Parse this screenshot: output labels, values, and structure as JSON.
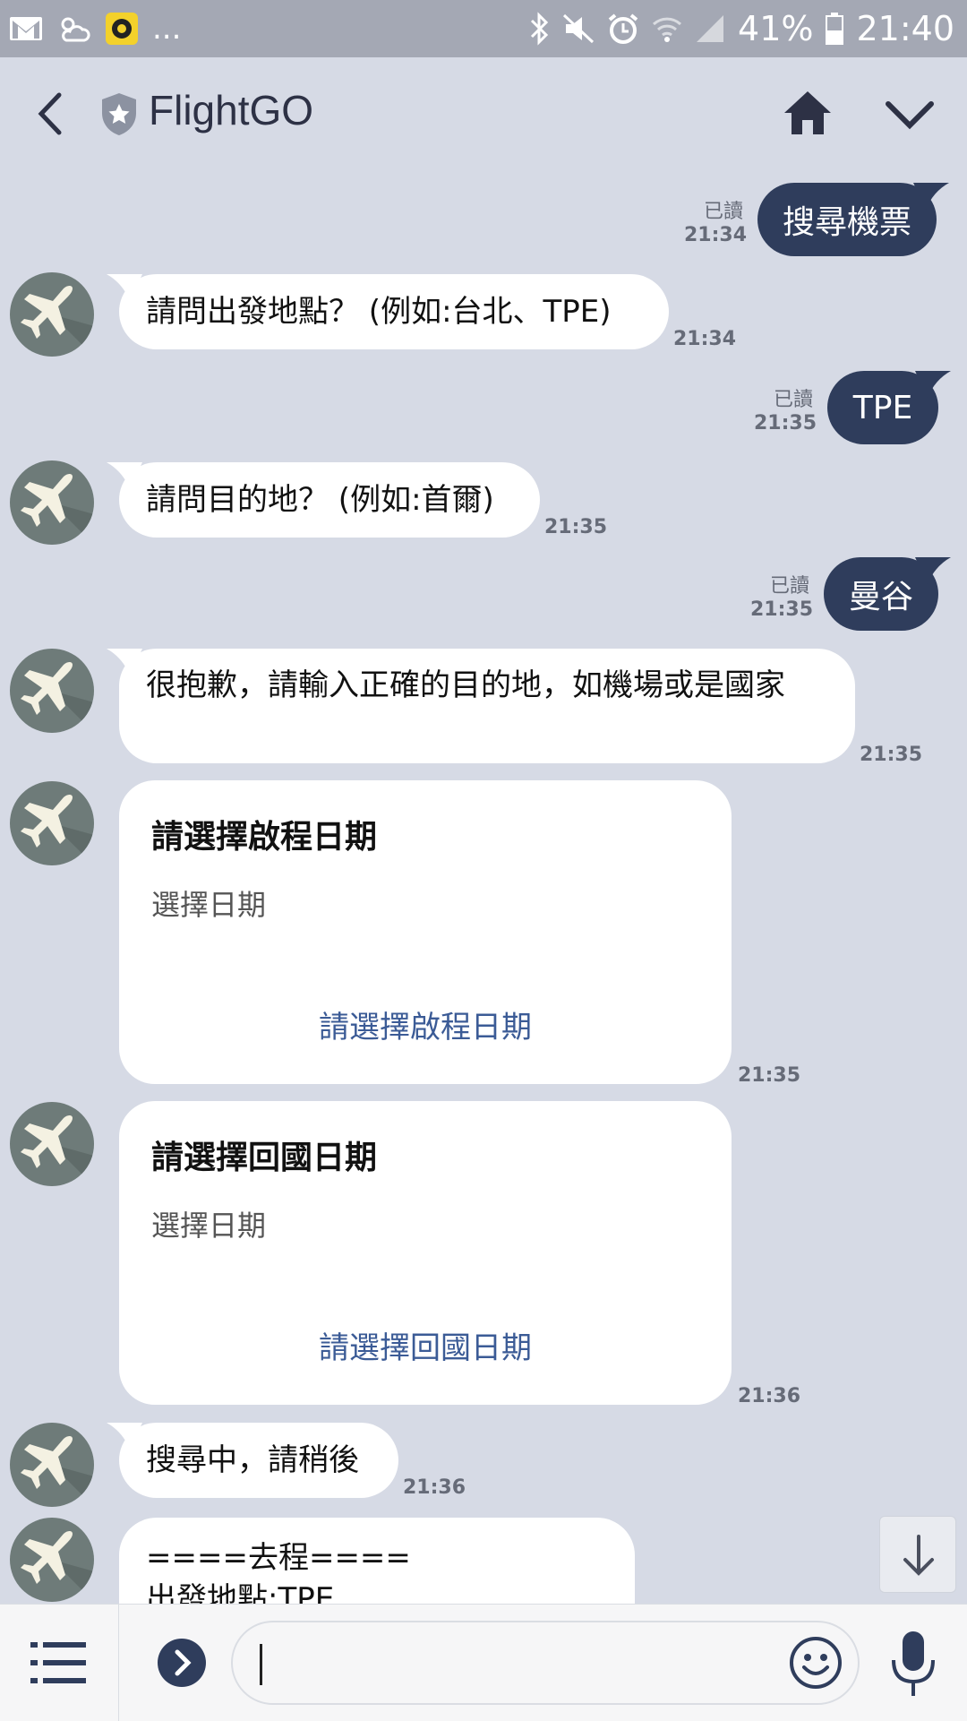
{
  "status_bar": {
    "battery": "41%",
    "time": "21:40",
    "more": "..."
  },
  "header": {
    "title": "FlightGO"
  },
  "messages": [
    {
      "from": "user",
      "text": "搜尋機票",
      "read": "已讀",
      "time": "21:34"
    },
    {
      "from": "bot",
      "text": "請問出發地點？ (例如:台北、TPE)",
      "time": "21:34"
    },
    {
      "from": "user",
      "text": "TPE",
      "read": "已讀",
      "time": "21:35"
    },
    {
      "from": "bot",
      "text": "請問目的地？ (例如:首爾)",
      "time": "21:35"
    },
    {
      "from": "user",
      "text": "曼谷",
      "read": "已讀",
      "time": "21:35"
    },
    {
      "from": "bot",
      "text": "很抱歉，請輸入正確的目的地，如機場或是國家",
      "time": "21:35"
    },
    {
      "from": "bot",
      "type": "card",
      "title": "請選擇啟程日期",
      "subtitle": "選擇日期",
      "action": "請選擇啟程日期",
      "time": "21:35"
    },
    {
      "from": "bot",
      "type": "card",
      "title": "請選擇回國日期",
      "subtitle": "選擇日期",
      "action": "請選擇回國日期",
      "time": "21:36"
    },
    {
      "from": "bot",
      "text": "搜尋中，請稍後",
      "time": "21:36"
    },
    {
      "from": "bot",
      "lines": [
        "====去程====",
        "出發地點:TPE"
      ]
    }
  ],
  "icons": {
    "back": "back-arrow-icon",
    "shield": "verified-shield-icon",
    "home": "home-icon",
    "collapse": "chevron-down-icon",
    "avatar": "airplane-icon",
    "scroll": "arrow-down-icon",
    "menu": "list-menu-icon",
    "expand": "chevron-right-icon",
    "emoji": "smiley-icon",
    "mic": "microphone-icon"
  },
  "colors": {
    "background": "#d6dae5",
    "user_bubble": "#2f3d5c",
    "link": "#3b5b96"
  }
}
